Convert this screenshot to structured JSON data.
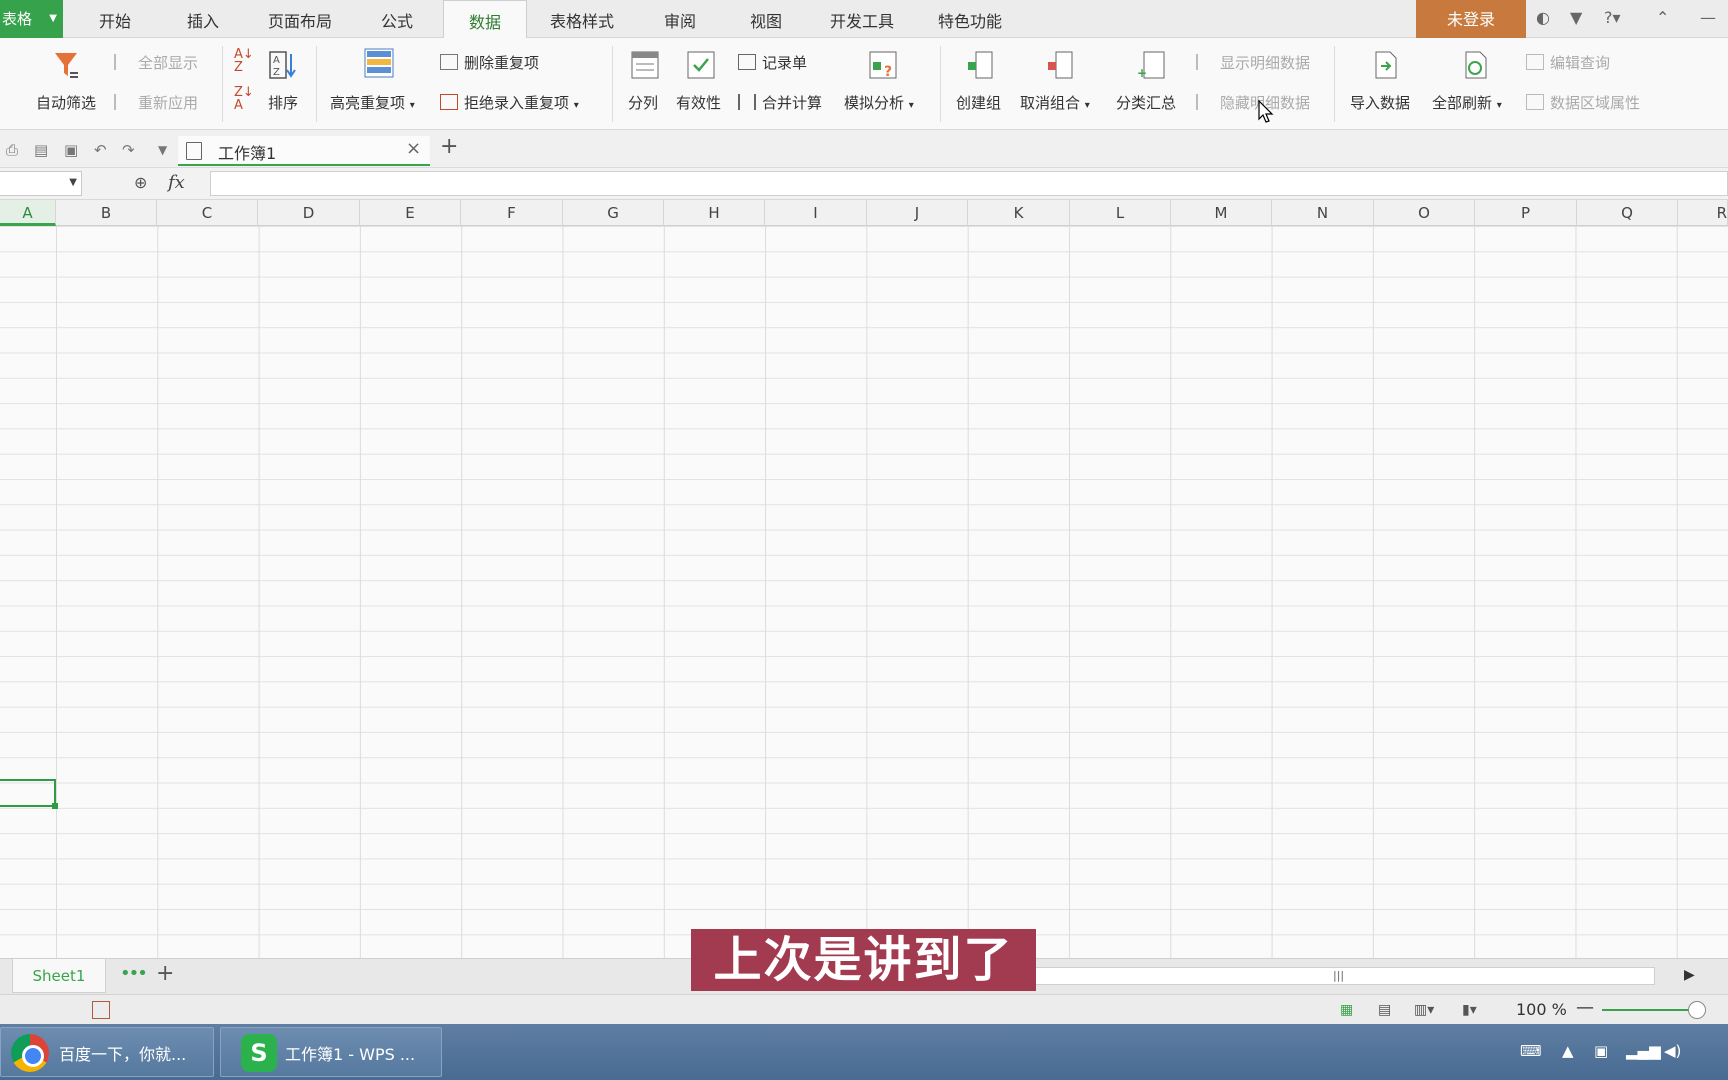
{
  "app": {
    "menu_label": "表格"
  },
  "menu": {
    "tabs": [
      "开始",
      "插入",
      "页面布局",
      "公式",
      "数据",
      "表格样式",
      "审阅",
      "视图",
      "开发工具",
      "特色功能"
    ],
    "active": "数据",
    "login_label": "未登录"
  },
  "ribbon": {
    "auto_filter": "自动筛选",
    "show_all": "全部显示",
    "reapply": "重新应用",
    "sort": "排序",
    "highlight_dup": "高亮重复项",
    "delete_dup": "删除重复项",
    "reject_dup": "拒绝录入重复项",
    "split_column": "分列",
    "validity": "有效性",
    "record_form": "记录单",
    "merge_calc": "合并计算",
    "what_if": "模拟分析",
    "create_group": "创建组",
    "ungroup": "取消组合",
    "subtotal": "分类汇总",
    "show_detail": "显示明细数据",
    "hide_detail": "隐藏明细数据",
    "import_data": "导入数据",
    "refresh_all": "全部刷新",
    "edit_query": "编辑查询",
    "range_props": "数据区域属性"
  },
  "document": {
    "tab_title": "工作簿1"
  },
  "formula": {
    "fx_label": "fx",
    "namebox_value": ""
  },
  "columns": [
    "A",
    "B",
    "C",
    "D",
    "E",
    "F",
    "G",
    "H",
    "I",
    "J",
    "K",
    "L",
    "M",
    "N",
    "O",
    "P",
    "Q",
    "R"
  ],
  "sheets": {
    "tab": "Sheet1",
    "more": "•••",
    "add": "+"
  },
  "status": {
    "zoom": "100 %"
  },
  "taskbar": {
    "chrome_label": "百度一下，你就...",
    "wps_label": "工作簿1 - WPS ..."
  },
  "subtitle": "上次是讲到了",
  "colors": {
    "accent": "#36a24b",
    "login": "#c87a3e",
    "subtitle_bg": "#a23a50"
  }
}
